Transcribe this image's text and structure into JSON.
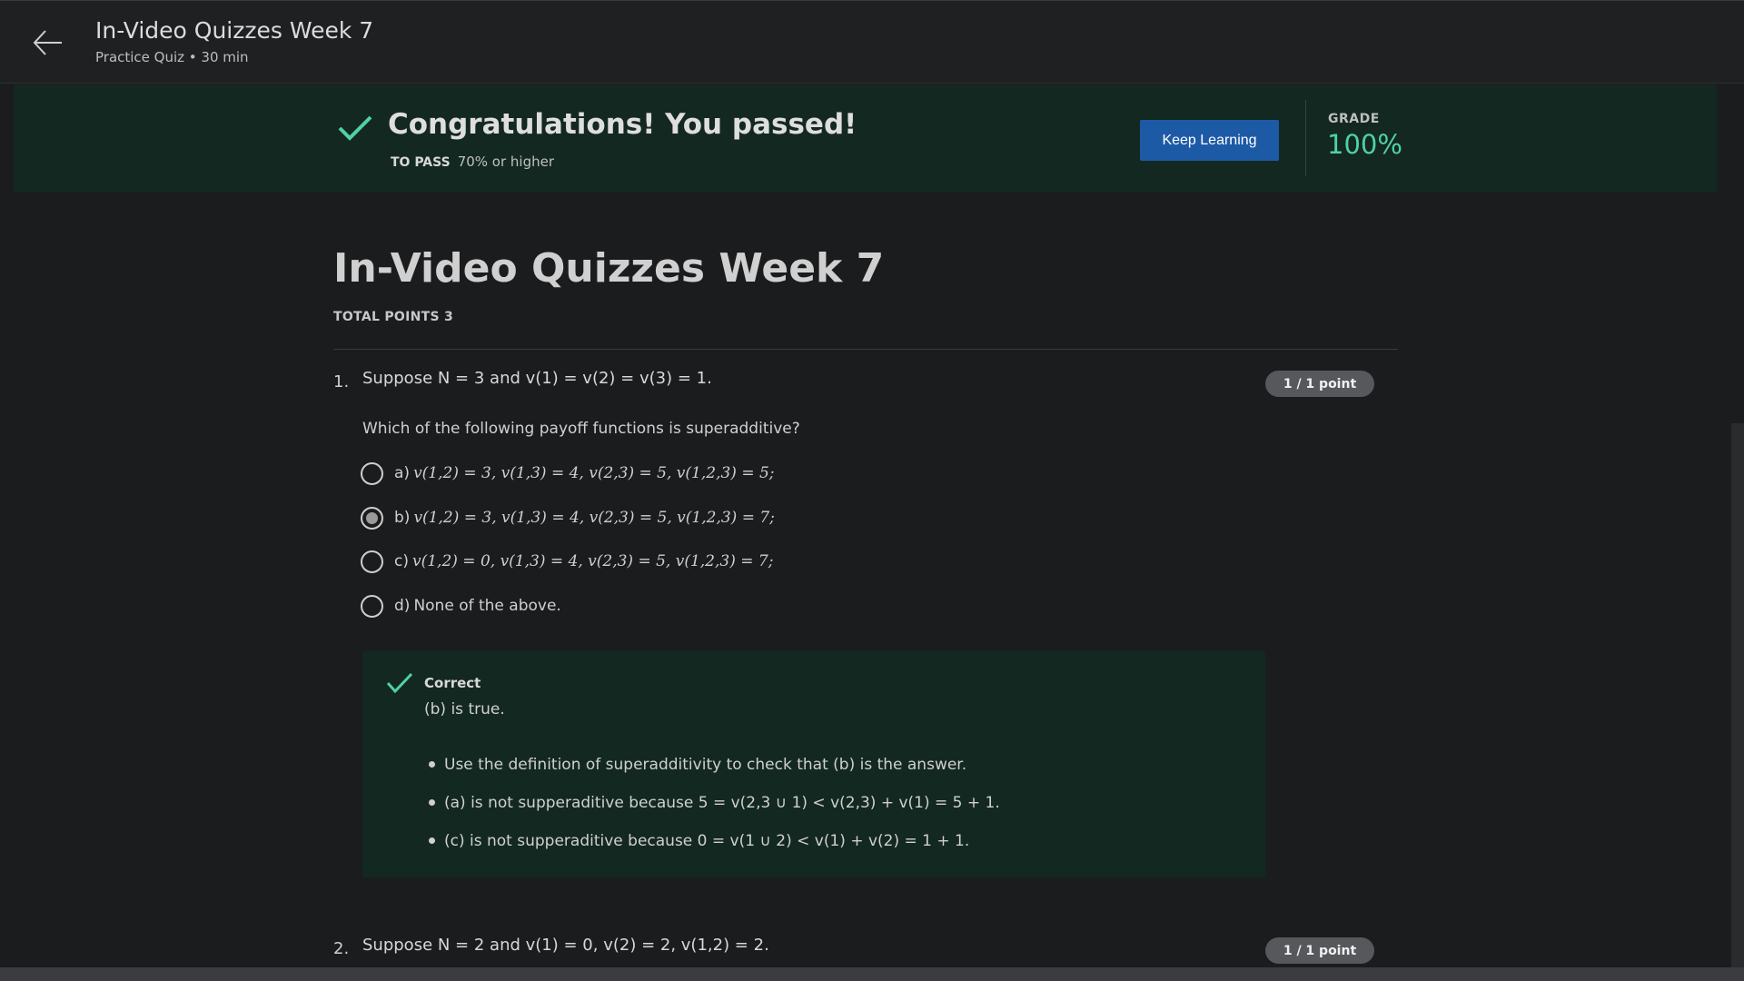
{
  "header": {
    "title": "In-Video Quizzes Week 7",
    "subtitle": "Practice Quiz • 30 min"
  },
  "banner": {
    "title": "Congratulations! You passed!",
    "to_pass_label": "TO PASS",
    "to_pass_value": "70% or higher",
    "keep_learning_label": "Keep Learning",
    "grade_label": "GRADE",
    "grade_value": "100%"
  },
  "quiz": {
    "title": "In-Video Quizzes Week 7",
    "total_points": "TOTAL POINTS 3"
  },
  "questions": [
    {
      "number": "1.",
      "stem": "Suppose N = 3 and v(1) = v(2) = v(3) = 1.",
      "points": "1 / 1 point",
      "prompt": "Which of the following payoff functions is superadditive?",
      "options": [
        {
          "letter": "a)",
          "text": "v(1,2) = 3, v(1,3) = 4, v(2,3) = 5, v(1,2,3) = 5;",
          "selected": false
        },
        {
          "letter": "b)",
          "text": "v(1,2) = 3, v(1,3) = 4, v(2,3) = 5, v(1,2,3) = 7;",
          "selected": true
        },
        {
          "letter": "c)",
          "text": "v(1,2) = 0, v(1,3) = 4, v(2,3) = 5, v(1,2,3) = 7;",
          "selected": false
        },
        {
          "letter": "d)",
          "text": "None of the above.",
          "selected": false
        }
      ],
      "feedback": {
        "status": "Correct",
        "summary": "(b) is true.",
        "bullets": [
          "Use the definition of superadditivity to check that (b) is the answer.",
          "(a) is not supperaditive because 5 = v(2,3 ∪ 1) < v(2,3) + v(1) = 5 + 1.",
          "(c) is not supperaditive because 0 = v(1 ∪ 2) < v(1) + v(2) = 1 + 1."
        ]
      }
    },
    {
      "number": "2.",
      "stem": "Suppose N = 2 and v(1) = 0, v(2) = 2, v(1,2) = 2.",
      "points": "1 / 1 point"
    }
  ],
  "colors": {
    "background": "#1b1c1e",
    "banner_bg": "#132821",
    "success_green": "#4fd1a5",
    "button_blue": "#1d5aa6",
    "badge_gray": "#56585b"
  },
  "icons": {
    "back": "arrow-left-icon",
    "pass": "checkmark-icon",
    "correct": "checkmark-icon"
  }
}
